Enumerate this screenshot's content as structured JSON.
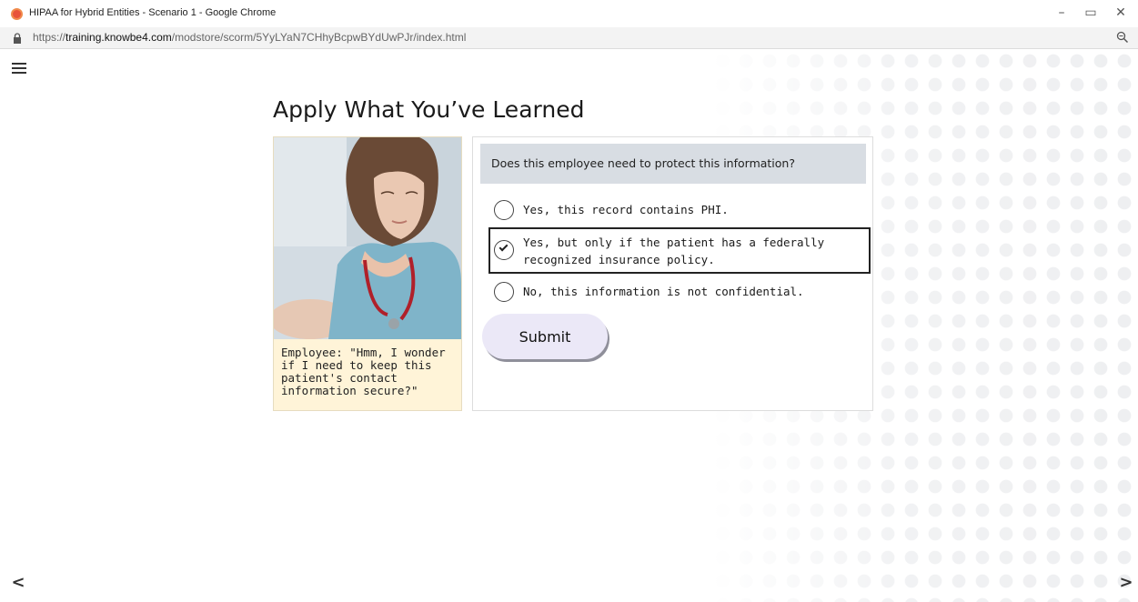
{
  "window": {
    "title": "HIPAA for Hybrid Entities - Scenario 1 - Google Chrome",
    "minimize": "–",
    "restore": "▭",
    "close": "✕"
  },
  "address": {
    "prefix": "https://",
    "domain": "training.knowbe4.com",
    "path": "/modstore/scorm/5YyLYaN7CHhyBcpwBYdUwPJr/index.html"
  },
  "page": {
    "title": "Apply What You’ve Learned"
  },
  "scenario": {
    "caption": "Employee: \"Hmm, I wonder if I need to keep this patient's contact information secure?\""
  },
  "question": {
    "prompt": "Does this employee need to protect this information?",
    "options": [
      {
        "label": "Yes, this record contains PHI.",
        "selected": false
      },
      {
        "label": "Yes, but only if the patient has a federally recognized insurance policy.",
        "selected": true
      },
      {
        "label": "No, this information is not confidential.",
        "selected": false
      }
    ],
    "submit_label": "Submit"
  },
  "nav": {
    "prev": "<",
    "next": ">"
  },
  "colors": {
    "caption_bg": "#fff4d8",
    "question_bar_bg": "#d8dde3",
    "submit_bg": "#ebe8f7"
  }
}
